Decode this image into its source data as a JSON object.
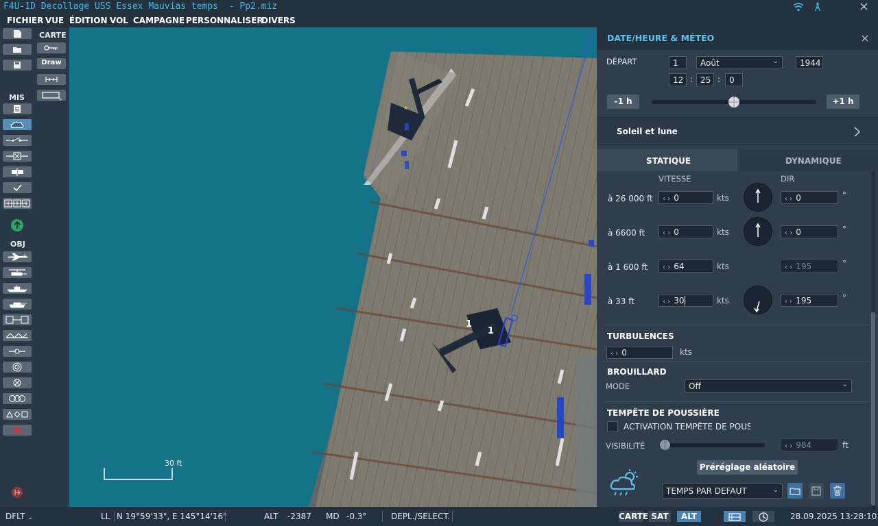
{
  "window": {
    "title": "F4U-1D Decollage USS Essex Mauvias temps  - Pp2.miz",
    "wifi_icon": "wifi-icon",
    "signal_icon": "antenna-icon",
    "close_icon": "close-icon",
    "accent_color": "#3fb6e6"
  },
  "menu": [
    "FICHIER",
    "VUE",
    "ÉDITION",
    "VOL",
    "CAMPAGNE",
    "PERSONNALISER",
    "DIVERS"
  ],
  "toolbar": {
    "carte_label": "CARTE",
    "draw_label": "Draw",
    "mis_label": "MIS",
    "obj_label": "OBJ"
  },
  "map": {
    "scale_label": "30 ft",
    "aircraft_label_1": "1",
    "aircraft_label_2": "1",
    "water_color": "#157389"
  },
  "panel": {
    "title": "DATE/HEURE & MÉTÉO",
    "depart_label": "DÉPART",
    "day": "1",
    "month": "Août",
    "year": "1944",
    "hour": "12",
    "minute": "25",
    "second": "0",
    "time_sep": ":",
    "minus_label": "-1 h",
    "plus_label": "+1 h",
    "time_slider_fraction": 0.5,
    "sun_moon_label": "Soleil et lune",
    "tab_static": "STATIQUE",
    "tab_dynamic": "DYNAMIQUE",
    "speed_col": "VITESSE",
    "dir_col": "DIR",
    "winds": [
      {
        "alt": "à 26 000 ft",
        "speed": "0",
        "unit": "kts",
        "dir": "0",
        "deg": "°"
      },
      {
        "alt": "à 6600 ft",
        "speed": "0",
        "unit": "kts",
        "dir": "0",
        "deg": "°"
      },
      {
        "alt": "à 1 600 ft",
        "speed": "64",
        "unit": "kts",
        "dir": "195",
        "deg": "°"
      },
      {
        "alt": "à 33 ft",
        "speed": "30",
        "unit": "kts",
        "dir": "195",
        "deg": "°"
      }
    ],
    "turbulence_label": "TURBULENCES",
    "turbulence_value": "0",
    "turbulence_unit": "kts",
    "fog_label": "BROUILLARD",
    "fog_mode_label": "MODE",
    "fog_mode_value": "Off",
    "dust_label": "TEMPÊTE DE POUSSIÈRE",
    "dust_activation_label": "ACTIVATION TEMPÊTE DE POUSS",
    "visibility_label": "VISIBILITÉ",
    "visibility_value": "984",
    "visibility_unit": "ft",
    "random_preset_label": "Préréglage aléatoire",
    "preset_value": "TEMPS PAR DEFAUT"
  },
  "status": {
    "mode": "DFLT",
    "coord_label": "LL",
    "coords": "N 19°59'33\", E 145°14'16\"",
    "alt_label": "ALT",
    "alt_value": "-2387",
    "md_label": "MD",
    "md_value": "-0.3°",
    "action": "DEPL./SELECT.",
    "btn_map": "CARTE",
    "btn_sat": "SAT",
    "btn_alt": "ALT",
    "datetime": "28.09.2025 13:28:10"
  }
}
